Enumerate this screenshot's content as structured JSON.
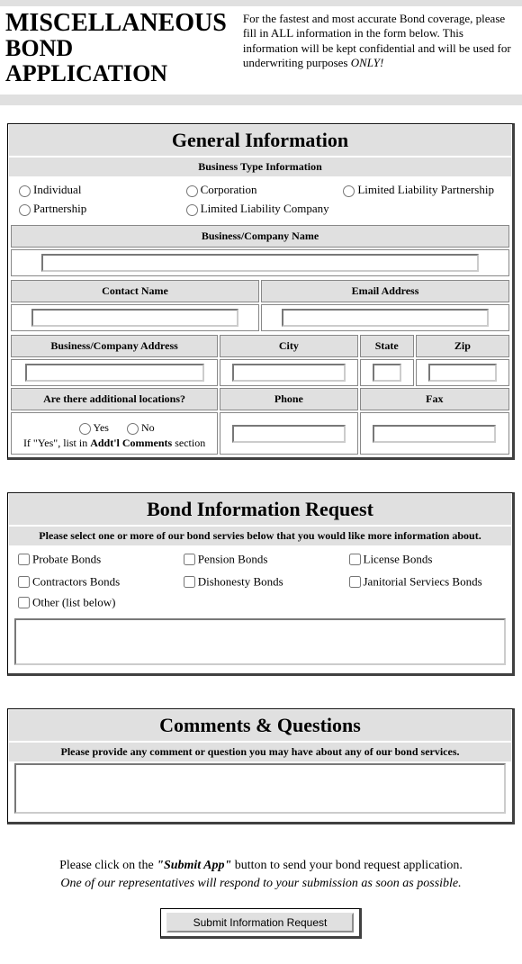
{
  "header": {
    "title_line1": "MISCELLANEOUS",
    "title_line2": "BOND",
    "title_line3": "APPLICATION",
    "intro_pre": "For the fastest and most accurate Bond coverage, please fill in ALL information in the form below. This information will be kept confidential and will be used for underwriting purposes ",
    "intro_only": "ONLY!"
  },
  "general": {
    "title": "General Information",
    "biz_type_head": "Business Type Information",
    "radios": {
      "individual": "Individual",
      "partnership": "Partnership",
      "corporation": "Corporation",
      "llc": "Limited Liability Company",
      "llp": "Limited Liability Partnership"
    },
    "company_name_head": "Business/Company Name",
    "contact_name_head": "Contact Name",
    "email_head": "Email Address",
    "address_head": "Business/Company Address",
    "city_head": "City",
    "state_head": "State",
    "zip_head": "Zip",
    "addl_loc_head": "Are there additional locations?",
    "phone_head": "Phone",
    "fax_head": "Fax",
    "yes": "Yes",
    "no": "No",
    "addl_note_pre": "If \"Yes\", list in ",
    "addl_note_bold": "Addt'l Comments",
    "addl_note_post": " section"
  },
  "bond": {
    "title": "Bond Information Request",
    "instruct": "Please select one or more of our bond servies below that you would like more information about.",
    "checks": {
      "probate": "Probate Bonds",
      "contractors": "Contractors Bonds",
      "pension": "Pension Bonds",
      "dishonesty": "Dishonesty Bonds",
      "license": "License Bonds",
      "janitorial": "Janitorial Serviecs Bonds",
      "other": "Other (list below)"
    }
  },
  "comments": {
    "title": "Comments & Questions",
    "instruct": "Please provide any comment or question you may have about any of our bond services."
  },
  "footer": {
    "line1_pre": "Please click on the ",
    "line1_quote": "\"Submit App\"",
    "line1_post": " button to send your bond request application.",
    "line2": "One of our representatives will respond to your submission as soon as possible.",
    "button": "Submit Information Request"
  }
}
